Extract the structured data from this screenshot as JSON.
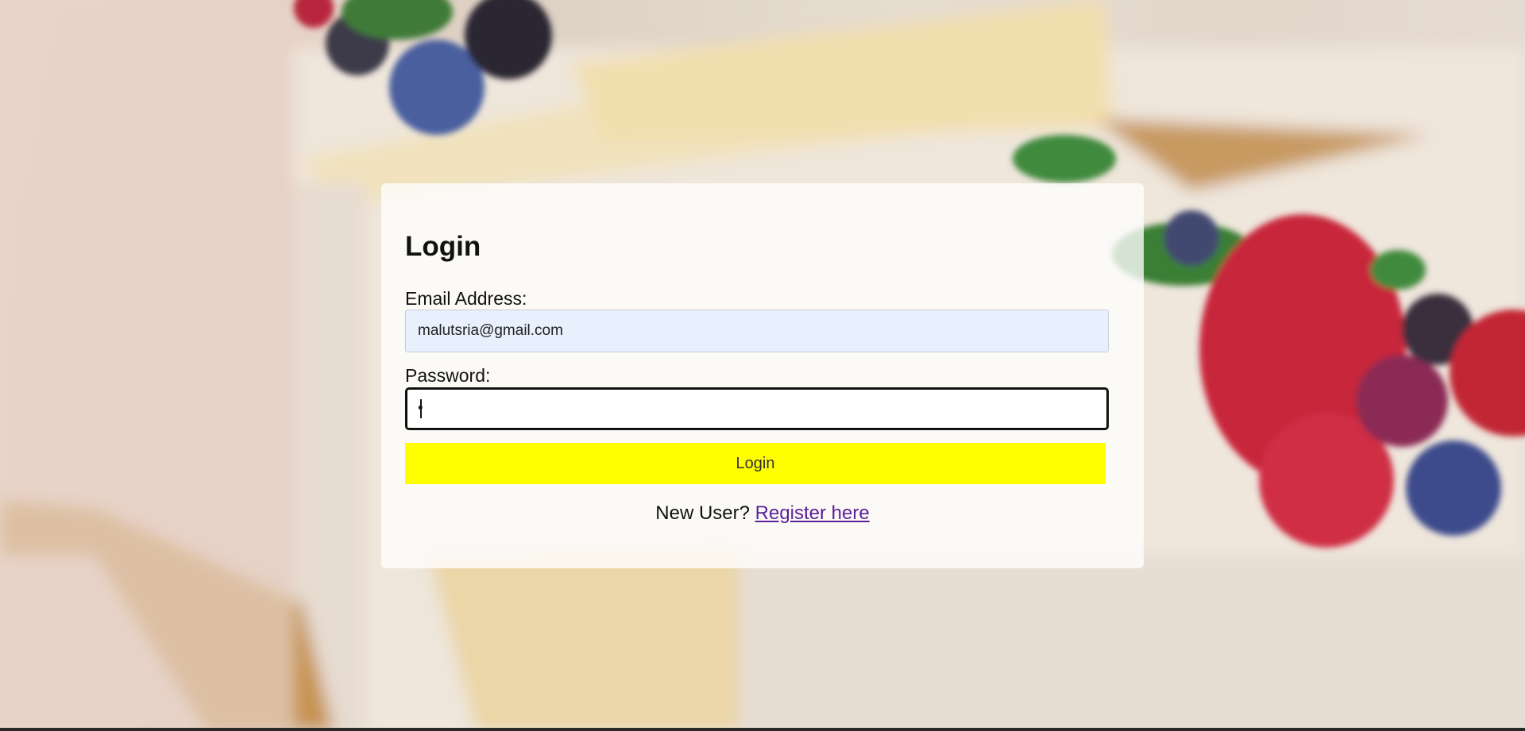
{
  "login": {
    "title": "Login",
    "email_label": "Email Address:",
    "email_value": "malutsria@gmail.com",
    "password_label": "Password:",
    "password_value": "•",
    "login_button": "Login",
    "new_user_text": "New User?",
    "register_link": "Register here"
  },
  "colors": {
    "button": "#ffff00",
    "link": "#5a1f99",
    "email_field_bg": "#e8effd"
  }
}
